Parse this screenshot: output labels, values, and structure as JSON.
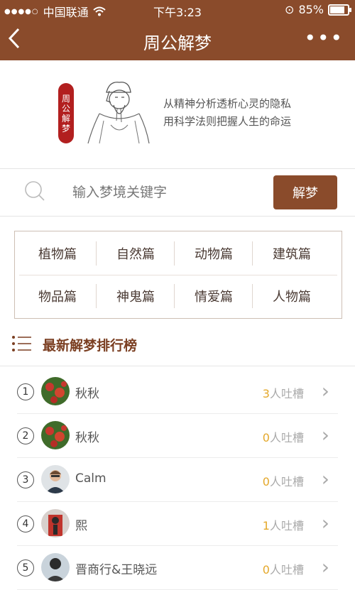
{
  "status": {
    "carrier": "中国联通",
    "time": "下午3:23",
    "battery": "85%",
    "battery_level": 0.85
  },
  "nav": {
    "back": "<",
    "title": "周公解梦",
    "more": "•••"
  },
  "hero": {
    "seal_text": [
      "周",
      "公",
      "解",
      "梦"
    ],
    "line1": "从精神分析透析心灵的隐私",
    "line2": "用科学法则把握人生的命运"
  },
  "search": {
    "placeholder": "输入梦境关键字",
    "button": "解梦"
  },
  "categories": [
    "植物篇",
    "自然篇",
    "动物篇",
    "建筑篇",
    "物品篇",
    "神鬼篇",
    "情爱篇",
    "人物篇"
  ],
  "ranking": {
    "title": "最新解梦排行榜",
    "items": [
      {
        "rank": "1",
        "name": "秋秋",
        "num": "3",
        "suffix": "人吐槽"
      },
      {
        "rank": "2",
        "name": "秋秋",
        "num": "0",
        "suffix": "人吐槽"
      },
      {
        "rank": "3",
        "name": "Calm",
        "num": "0",
        "suffix": "人吐槽"
      },
      {
        "rank": "4",
        "name": "熙",
        "num": "1",
        "suffix": "人吐槽"
      },
      {
        "rank": "5",
        "name": "晋商行&王晓远",
        "num": "0",
        "suffix": "人吐槽"
      }
    ]
  },
  "colors": {
    "brand": "#8a4b2b",
    "count_highlight": "#e4a82b",
    "seal": "#b21f1f"
  }
}
